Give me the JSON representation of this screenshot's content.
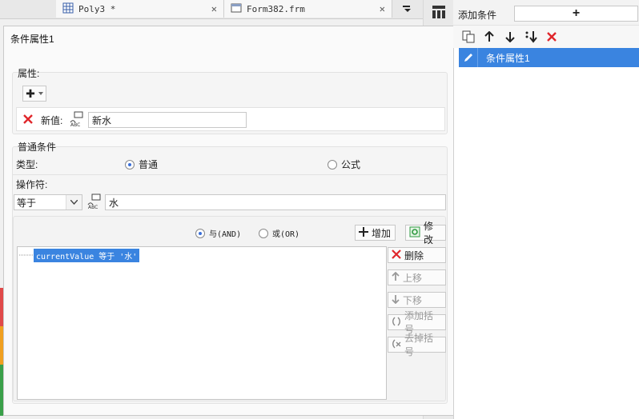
{
  "editor_tabs": [
    {
      "label": "Poly3 *",
      "close": "✕"
    },
    {
      "label": "Form382.frm",
      "close": "✕"
    }
  ],
  "dialog": {
    "title": "条件属性1",
    "property_section": {
      "header": "属性:",
      "add_glyph": "✚",
      "new_value_label": "新值:",
      "new_value": "新水"
    },
    "condition_section": {
      "header": "普通条件",
      "type_label": "类型:",
      "type_options": [
        "普通",
        "公式"
      ],
      "operator_label": "操作符:",
      "operator_value": "等于",
      "operand_value": "水",
      "logic_options": [
        "与(AND)",
        "或(OR)"
      ],
      "add_label": "增加",
      "modify_label": "修改",
      "conditions": [
        "currentValue 等于 '水'"
      ],
      "delete_label": "删除",
      "up_label": "上移",
      "down_label": "下移",
      "add_bracket_label": "添加括号",
      "remove_bracket_label": "去掉括号"
    }
  },
  "right_panel": {
    "add_condition_label": "添加条件",
    "add_glyph": "+",
    "items": [
      "条件属性1"
    ]
  },
  "colors": {
    "selection": "#3a84e0",
    "delete_red": "#e0262b",
    "accent_green": "#2e9a40"
  }
}
